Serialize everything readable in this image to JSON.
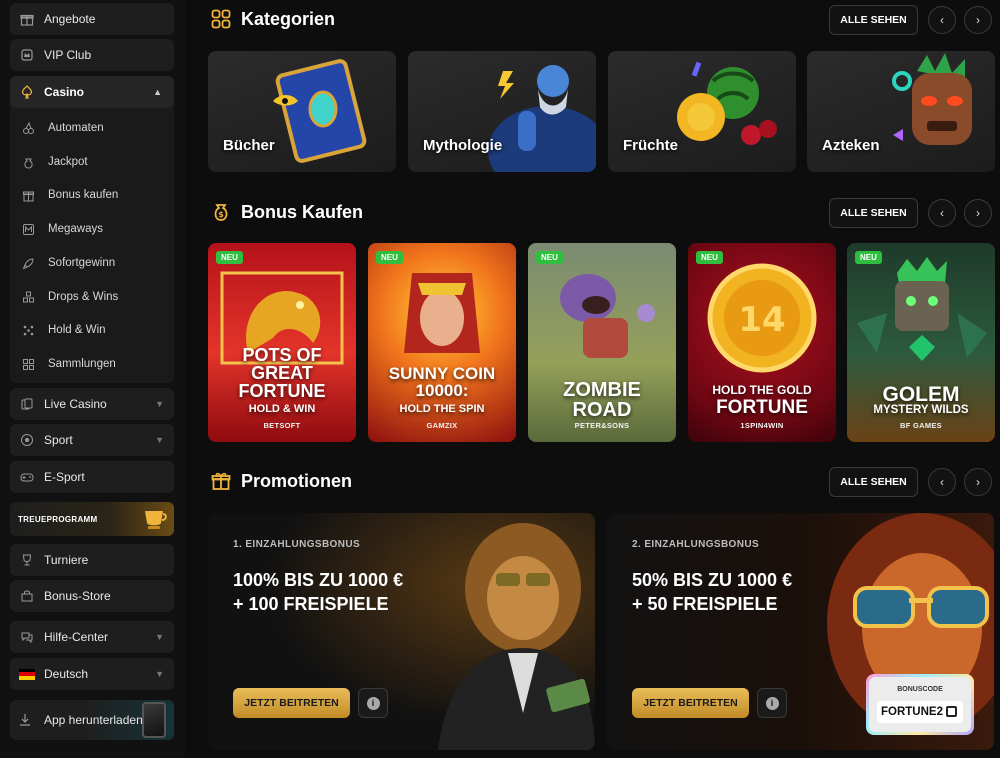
{
  "sidebar": {
    "items_top": [
      {
        "label": "Angebote",
        "icon": "gift-icon"
      },
      {
        "label": "VIP Club",
        "icon": "crown-icon"
      }
    ],
    "casino": {
      "label": "Casino",
      "icon": "spade-icon",
      "sub_items": [
        {
          "label": "Automaten",
          "icon": "cherry-icon"
        },
        {
          "label": "Jackpot",
          "icon": "moneybag-icon"
        },
        {
          "label": "Bonus kaufen",
          "icon": "gift-box-icon"
        },
        {
          "label": "Megaways",
          "icon": "megaways-icon"
        },
        {
          "label": "Sofortgewinn",
          "icon": "rocket-icon"
        },
        {
          "label": "Drops & Wins",
          "icon": "blocks-icon"
        },
        {
          "label": "Hold & Win",
          "icon": "grid-dots-icon"
        },
        {
          "label": "Sammlungen",
          "icon": "collection-icon"
        }
      ]
    },
    "items_mid": [
      {
        "label": "Live Casino",
        "icon": "cards-icon"
      },
      {
        "label": "Sport",
        "icon": "football-icon"
      },
      {
        "label": "E-Sport",
        "icon": "gamepad-icon"
      }
    ],
    "treue": "TREUEPROGRAMM",
    "items_bottom": [
      {
        "label": "Turniere",
        "icon": "trophy-icon"
      },
      {
        "label": "Bonus-Store",
        "icon": "store-icon"
      },
      {
        "label": "Hilfe-Center",
        "icon": "chat-icon"
      },
      {
        "label": "Deutsch",
        "icon": "flag-de-icon"
      }
    ],
    "app_download": "App herunterladen"
  },
  "sections": {
    "kategorien": {
      "title": "Kategorien",
      "see_all": "ALLE SEHEN",
      "cards": [
        "Bücher",
        "Mythologie",
        "Früchte",
        "Azteken"
      ]
    },
    "bonus_kaufen": {
      "title": "Bonus Kaufen",
      "see_all": "ALLE SEHEN",
      "games": [
        {
          "badge": "NEU",
          "title_lines": [
            "POTS OF",
            "GREAT",
            "FORTUNE"
          ],
          "subtitle": "HOLD & WIN",
          "provider": "BETSOFT"
        },
        {
          "badge": "NEU",
          "title_lines": [
            "SUNNY COIN",
            "10000:"
          ],
          "subtitle": "HOLD THE SPIN",
          "provider": "GAMZIX"
        },
        {
          "badge": "NEU",
          "title_lines": [
            "ZOMBIE",
            "ROAD"
          ],
          "subtitle": "",
          "provider": "PETER&SONS"
        },
        {
          "badge": "NEU",
          "title_lines": [
            "HOLD THE GOLD",
            "FORTUNE"
          ],
          "subtitle": "",
          "provider": "1SPIN4WIN"
        },
        {
          "badge": "NEU",
          "title_lines": [
            "GOLEM"
          ],
          "subtitle": "MYSTERY WILDS",
          "provider": "BF GAMES"
        }
      ]
    },
    "promotionen": {
      "title": "Promotionen",
      "see_all": "ALLE SEHEN",
      "promos": [
        {
          "kicker": "1. EINZAHLUNGSBONUS",
          "headline_1": "100% BIS ZU 1000 €",
          "headline_2": "+ 100 FREISPIELE",
          "button": "JETZT BEITRETEN"
        },
        {
          "kicker": "2. EINZAHLUNGSBONUS",
          "headline_1": "50% BIS ZU 1000 €",
          "headline_2": "+ 50 FREISPIELE",
          "button": "JETZT BEITRETEN",
          "code_label": "BONUSCODE",
          "code": "FORTUNE2"
        }
      ]
    }
  },
  "colors": {
    "accent": "#f0b43c",
    "badge": "#2fbf3f",
    "bg": "#0d0d0d"
  }
}
